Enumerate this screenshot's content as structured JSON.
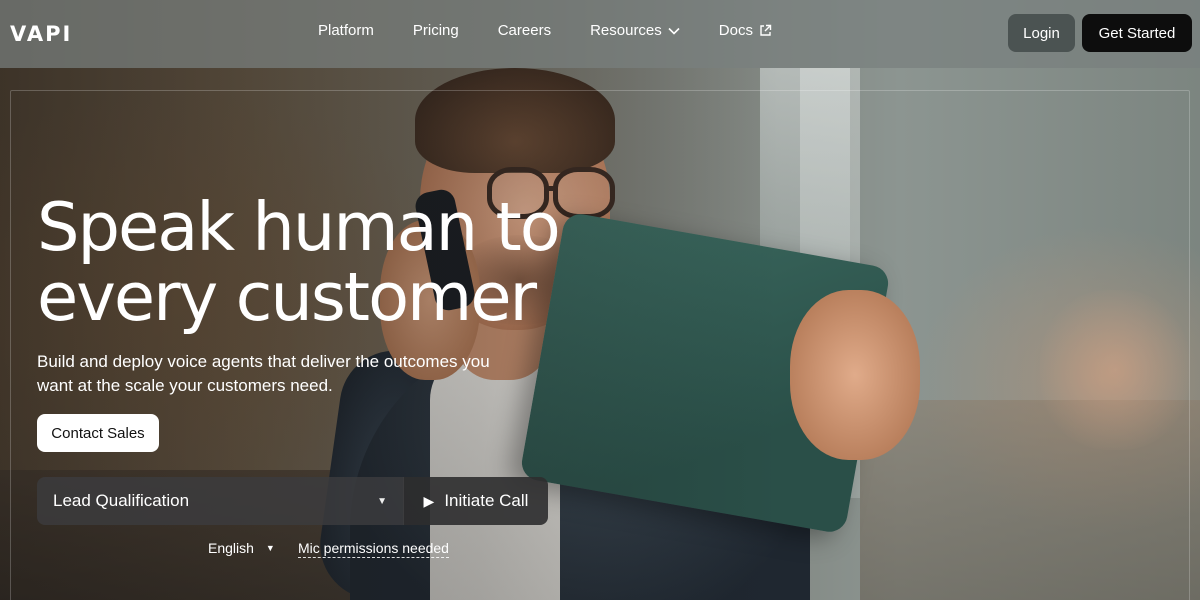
{
  "brand": {
    "logo_text": "VAPI"
  },
  "nav": {
    "links": [
      {
        "label": "Platform"
      },
      {
        "label": "Pricing"
      },
      {
        "label": "Careers"
      },
      {
        "label": "Resources",
        "icon": "chevron-down-icon"
      },
      {
        "label": "Docs",
        "icon": "external-link-icon"
      }
    ],
    "login_label": "Login",
    "get_started_label": "Get Started"
  },
  "hero": {
    "title_line1": "Speak human to",
    "title_line2": "every customer",
    "subtitle_line1": "Build and deploy voice agents that deliver the outcomes you",
    "subtitle_line2": "want at the scale your customers need.",
    "contact_label": "Contact Sales"
  },
  "call_widget": {
    "selected_agent": "Lead Qualification",
    "initiate_label": "Initiate Call",
    "language": "English",
    "mic_status": "Mic permissions needed"
  },
  "colors": {
    "get_started_bg": "#0d0d0d",
    "login_bg": "#4b5352",
    "contact_bg": "#ffffff"
  }
}
